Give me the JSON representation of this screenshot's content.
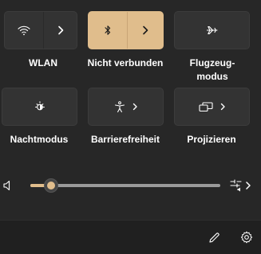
{
  "colors": {
    "accent": "#e0bd8c",
    "background": "#272727",
    "tile": "#333333",
    "footer": "#202020"
  },
  "tiles": [
    {
      "id": "wlan",
      "label": "WLAN",
      "icon": "wifi-icon",
      "active": false,
      "split": true
    },
    {
      "id": "bluetooth",
      "label": "Nicht verbunden",
      "icon": "bluetooth-icon",
      "active": true,
      "split": true
    },
    {
      "id": "airplane",
      "label": "Flugzeug-\nmodus",
      "label_line1": "Flugzeug-",
      "label_line2": "modus",
      "icon": "airplane-icon",
      "active": false,
      "split": false
    },
    {
      "id": "night",
      "label": "Nachtmodus",
      "icon": "night-light-icon",
      "active": false,
      "split": false
    },
    {
      "id": "accessibility",
      "label": "Barrierefreiheit",
      "icon": "accessibility-icon",
      "active": false,
      "split": false,
      "chevron": true
    },
    {
      "id": "project",
      "label": "Projizieren",
      "icon": "project-icon",
      "active": false,
      "split": false,
      "chevron": true
    }
  ],
  "volume": {
    "icon": "speaker-icon",
    "level_percent": 11,
    "output_icon": "sound-output-icon"
  },
  "footer": {
    "edit_icon": "pencil-icon",
    "settings_icon": "gear-icon"
  }
}
